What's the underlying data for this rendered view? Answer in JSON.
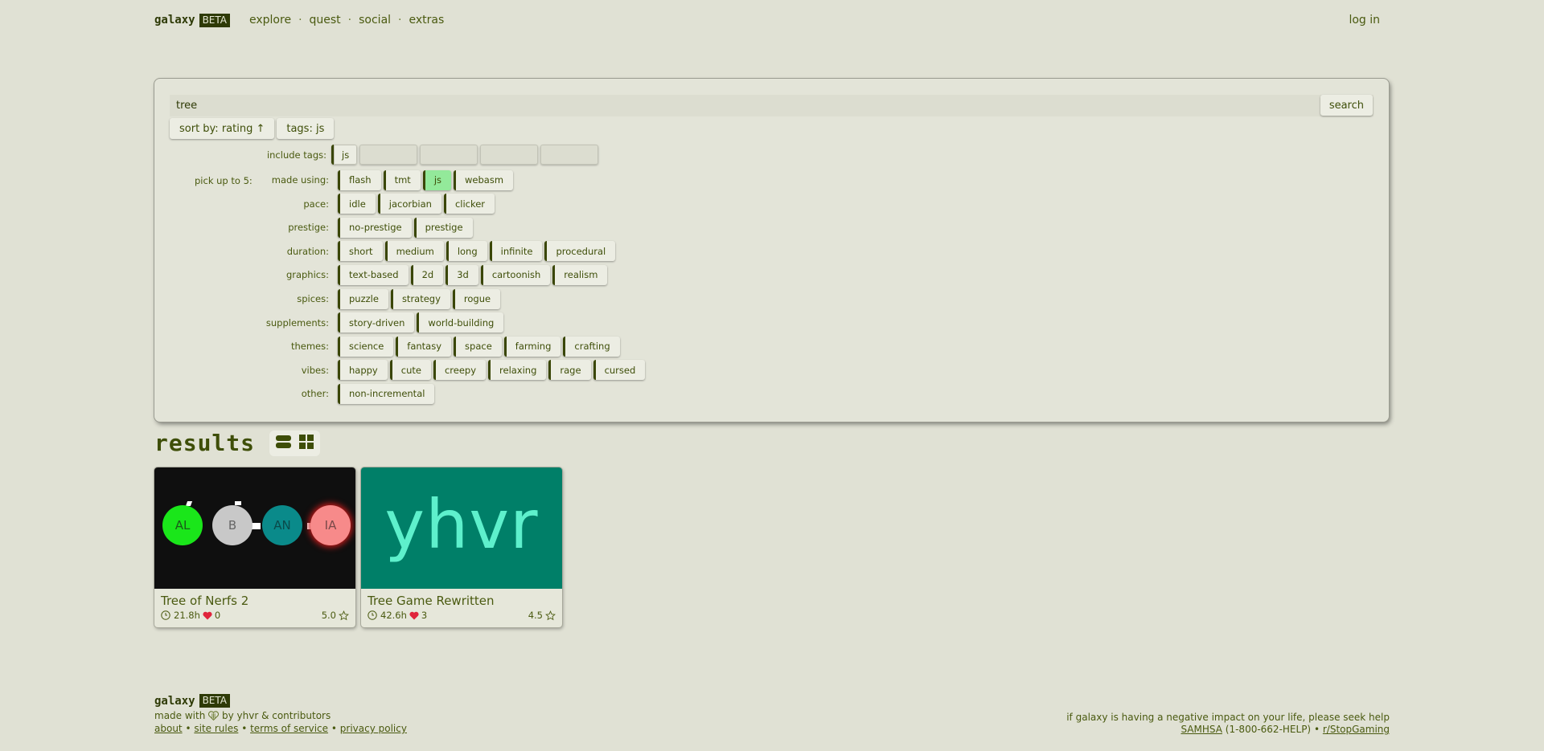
{
  "header": {
    "brand": "galaxy",
    "badge": "BETA",
    "nav": [
      "explore",
      "quest",
      "social",
      "extras"
    ],
    "nav_separator": "·",
    "login": "log in"
  },
  "search": {
    "query": "tree",
    "button": "search",
    "sort_label": "sort by: rating ↑",
    "tags_label": "tags: js",
    "include_tags_label": "include tags:",
    "included_tags": [
      "js"
    ],
    "pick_label": "pick up to 5:",
    "categories": [
      {
        "label": "made using:",
        "tags": [
          {
            "name": "flash"
          },
          {
            "name": "tmt"
          },
          {
            "name": "js",
            "active": true
          },
          {
            "name": "webasm"
          }
        ]
      },
      {
        "label": "pace:",
        "tags": [
          {
            "name": "idle"
          },
          {
            "name": "jacorbian"
          },
          {
            "name": "clicker"
          }
        ]
      },
      {
        "label": "prestige:",
        "tags": [
          {
            "name": "no-prestige"
          },
          {
            "name": "prestige"
          }
        ]
      },
      {
        "label": "duration:",
        "tags": [
          {
            "name": "short"
          },
          {
            "name": "medium"
          },
          {
            "name": "long"
          },
          {
            "name": "infinite"
          },
          {
            "name": "procedural"
          }
        ]
      },
      {
        "label": "graphics:",
        "tags": [
          {
            "name": "text-based"
          },
          {
            "name": "2d"
          },
          {
            "name": "3d"
          },
          {
            "name": "cartoonish"
          },
          {
            "name": "realism"
          }
        ]
      },
      {
        "label": "spices:",
        "tags": [
          {
            "name": "puzzle"
          },
          {
            "name": "strategy"
          },
          {
            "name": "rogue"
          }
        ]
      },
      {
        "label": "supplements:",
        "tags": [
          {
            "name": "story-driven"
          },
          {
            "name": "world-building"
          }
        ]
      },
      {
        "label": "themes:",
        "tags": [
          {
            "name": "science"
          },
          {
            "name": "fantasy"
          },
          {
            "name": "space"
          },
          {
            "name": "farming"
          },
          {
            "name": "crafting"
          }
        ]
      },
      {
        "label": "vibes:",
        "tags": [
          {
            "name": "happy"
          },
          {
            "name": "cute"
          },
          {
            "name": "creepy"
          },
          {
            "name": "relaxing"
          },
          {
            "name": "rage"
          },
          {
            "name": "cursed"
          }
        ]
      },
      {
        "label": "other:",
        "tags": [
          {
            "name": "non-incremental"
          }
        ]
      }
    ]
  },
  "results": {
    "title": "results",
    "view_options": [
      "list-view",
      "grid-view"
    ],
    "cards": [
      {
        "title": "Tree of Nerfs 2",
        "playtime": "21.8h",
        "likes": "0",
        "rating": "5.0",
        "thumbnail_nodes": [
          {
            "label": "AL",
            "color": "#1ae61a",
            "text": "#1a5a1a"
          },
          {
            "label": "B",
            "color": "#c8c8c8",
            "text": "#666666"
          },
          {
            "label": "AN",
            "color": "#0a8a8a",
            "text": "#0a4a4a"
          },
          {
            "label": "IA",
            "color": "#f78a8a",
            "text": "#7a4a4a"
          }
        ]
      },
      {
        "title": "Tree Game Rewritten",
        "playtime": "42.6h",
        "likes": "3",
        "rating": "4.5",
        "thumbnail_text": "yhvr"
      }
    ]
  },
  "footer": {
    "brand": "galaxy",
    "badge": "BETA",
    "made_with_prefix": "made with",
    "made_with_suffix": "by yhvr & contributors",
    "links": [
      "about",
      "site rules",
      "terms of service",
      "privacy policy"
    ],
    "link_separator": "•",
    "help_text": "if galaxy is having a negative impact on your life, please seek help",
    "samhsa": "SAMHSA",
    "samhsa_phone": "(1-800-662-HELP)",
    "stopgaming": "r/StopGaming"
  },
  "colors": {
    "background": "#e0e1d4",
    "accent_dark": "#2e3a06",
    "text": "#4a5a10",
    "tag_active": "#93e99a",
    "heart": "#e0243c"
  }
}
